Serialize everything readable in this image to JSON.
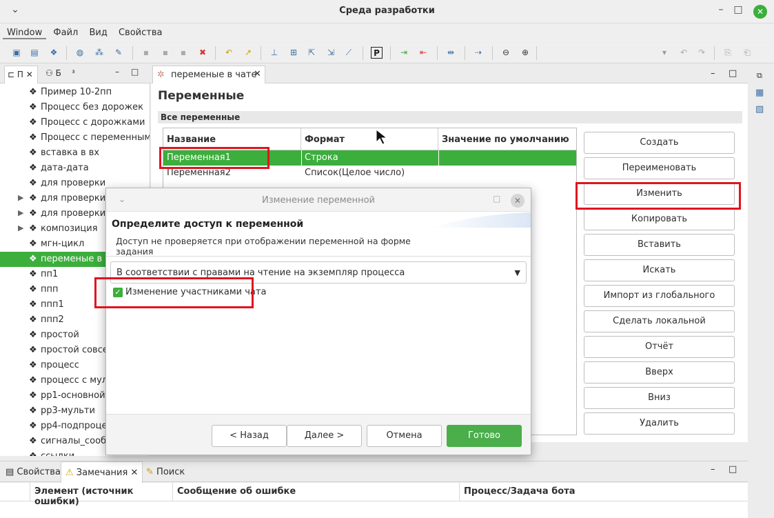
{
  "window": {
    "title": "Среда разработки",
    "collapse_glyph": "⌄",
    "minimize_glyph": "–",
    "maximize_glyph": "□",
    "close_glyph": "✕"
  },
  "menu": [
    "Window",
    "Файл",
    "Вид",
    "Свойства"
  ],
  "left_panel": {
    "tabs": [
      "П",
      "Б",
      "³"
    ],
    "items": [
      {
        "label": "Пример 10-2пп",
        "expandable": false,
        "selected": false
      },
      {
        "label": "Процесс без дорожек",
        "expandable": false,
        "selected": false
      },
      {
        "label": "Процесс с дорожками",
        "expandable": false,
        "selected": false
      },
      {
        "label": "Процесс с переменными",
        "expandable": false,
        "selected": false
      },
      {
        "label": "вставка в вх",
        "expandable": false,
        "selected": false
      },
      {
        "label": "дата-дата",
        "expandable": false,
        "selected": false
      },
      {
        "label": "для проверки",
        "expandable": false,
        "selected": false
      },
      {
        "label": "для проверки 2",
        "expandable": true,
        "selected": false
      },
      {
        "label": "для проверки 3",
        "expandable": true,
        "selected": false
      },
      {
        "label": "композиция",
        "expandable": true,
        "selected": false
      },
      {
        "label": "мгн-цикл",
        "expandable": false,
        "selected": false
      },
      {
        "label": "переменые в чате",
        "expandable": false,
        "selected": true
      },
      {
        "label": "пп1",
        "expandable": false,
        "selected": false
      },
      {
        "label": "ппп",
        "expandable": false,
        "selected": false
      },
      {
        "label": "ппп1",
        "expandable": false,
        "selected": false
      },
      {
        "label": "ппп2",
        "expandable": false,
        "selected": false
      },
      {
        "label": "простой",
        "expandable": false,
        "selected": false
      },
      {
        "label": "простой совсем",
        "expandable": false,
        "selected": false
      },
      {
        "label": "процесс",
        "expandable": false,
        "selected": false
      },
      {
        "label": "процесс с мульти",
        "expandable": false,
        "selected": false
      },
      {
        "label": "рр1-основной",
        "expandable": false,
        "selected": false
      },
      {
        "label": "рр3-мульти",
        "expandable": false,
        "selected": false
      },
      {
        "label": "рр4-подпроцесс",
        "expandable": false,
        "selected": false
      },
      {
        "label": "сигналы_сообщения",
        "expandable": false,
        "selected": false
      },
      {
        "label": "ссылки",
        "expandable": false,
        "selected": false
      }
    ]
  },
  "editor": {
    "tab_label": "переменые в чате",
    "page_title": "Переменные",
    "section_title": "Все переменные",
    "columns": [
      "Название",
      "Формат",
      "Значение по умолчанию"
    ],
    "rows": [
      {
        "name": "Переменная1",
        "format": "Строка",
        "default": "",
        "selected": true
      },
      {
        "name": "Переменная2",
        "format": "Список(Целое число)",
        "default": "",
        "selected": false
      }
    ],
    "buttons": [
      "Создать",
      "Переименовать",
      "Изменить",
      "Копировать",
      "Вставить",
      "Искать",
      "Импорт из глобального раздела",
      "Сделать локальной",
      "Отчёт",
      "Вверх",
      "Вниз",
      "Удалить"
    ]
  },
  "dialog": {
    "title": "Изменение переменной",
    "heading": "Определите доступ к переменной",
    "description": "Доступ не проверяется при отображении переменной на форме задания",
    "combo_value": "В соответствии с правами на чтение на экземпляр процесса",
    "checkbox_label": "Изменение участниками чата",
    "checkbox_checked": true,
    "buttons": {
      "back": "< Назад",
      "next": "Далее >",
      "cancel": "Отмена",
      "finish": "Готово"
    }
  },
  "bottom_panel": {
    "tabs": [
      "Свойства",
      "Замечания",
      "Поиск"
    ],
    "active_tab": "Замечания",
    "columns": [
      "Элемент (источник ошибки)",
      "Сообщение об ошибке",
      "Процесс/Задача бота"
    ]
  },
  "colors": {
    "accent": "#3cae3c",
    "highlight": "#e0141e"
  }
}
